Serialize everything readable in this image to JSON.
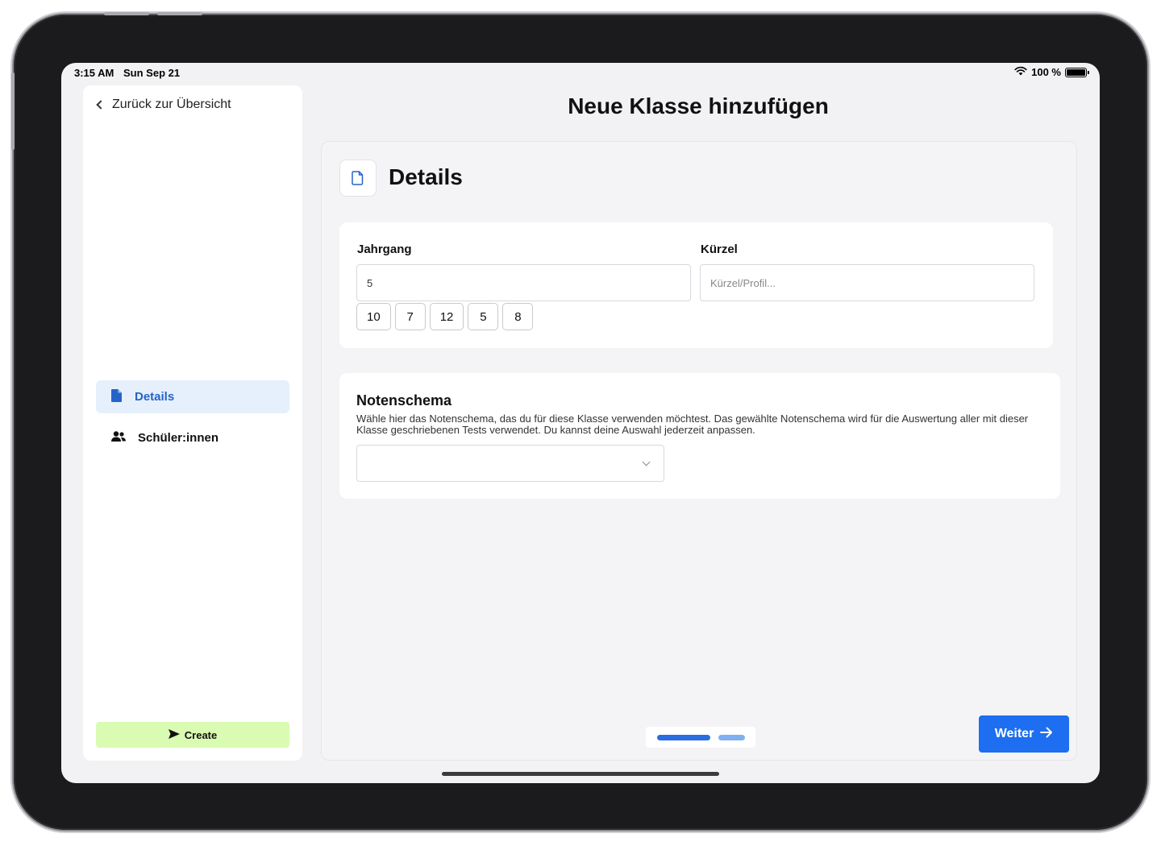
{
  "status_bar": {
    "time": "3:15 AM",
    "date": "Sun Sep 21",
    "battery": "100 %"
  },
  "sidebar": {
    "back_label": "Zurück zur Übersicht",
    "items": [
      {
        "label": "Details",
        "icon": "document-icon",
        "active": true
      },
      {
        "label": "Schüler:innen",
        "icon": "users-icon",
        "active": false
      }
    ],
    "create_label": "Create"
  },
  "main": {
    "page_title": "Neue Klasse hinzufügen",
    "section_title": "Details",
    "jahrgang": {
      "label": "Jahrgang",
      "value": "5",
      "chips": [
        "10",
        "7",
        "12",
        "5",
        "8"
      ]
    },
    "kuerzel": {
      "label": "Kürzel",
      "placeholder": "Kürzel/Profil..."
    },
    "notenschema": {
      "title": "Notenschema",
      "description": "Wähle hier das Notenschema, das du für diese Klasse verwenden möchtest. Das gewählte Notenschema wird für die Auswertung aller mit dieser Klasse geschriebenen Tests verwendet. Du kannst deine Auswahl jederzeit anpassen.",
      "selected": ""
    },
    "pager": {
      "steps": 2,
      "current": 1
    },
    "next_label": "Weiter"
  },
  "colors": {
    "accent": "#1d6ef0",
    "active_nav_bg": "#e6f0fc",
    "active_nav_text": "#2563c9",
    "create_bg": "#d9fbb2",
    "pager_active": "#2a6de3",
    "pager_inactive": "#7fb0f2"
  }
}
